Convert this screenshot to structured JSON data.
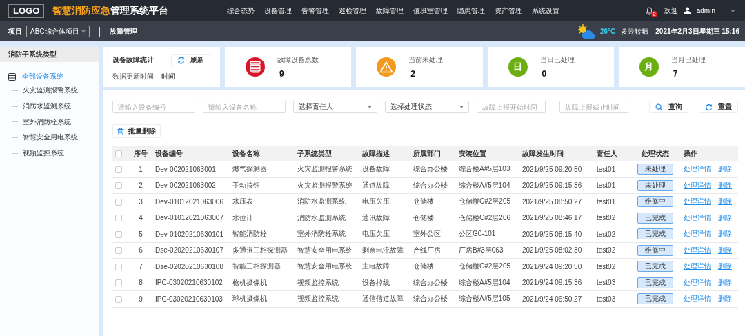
{
  "header": {
    "logo": "LOGO",
    "title_highlight": "智慧消防应急",
    "title_rest": "管理系统平台",
    "nav": [
      "综合态势",
      "设备管理",
      "告警管理",
      "巡检管理",
      "故障管理",
      "值班室管理",
      "隐患管理",
      "资产管理",
      "系统设置"
    ],
    "notification_count": "2",
    "welcome": "欢迎",
    "user": "admin"
  },
  "subbar": {
    "project_label": "项目",
    "project": "ABC综合体项目",
    "page_title": "故障管理",
    "temperature": "26°C",
    "weather": "多云转晴",
    "datetime": "2021年2月3日星期三 15:16"
  },
  "sidebar": {
    "title": "消防子系统类型",
    "tree": [
      {
        "label": "全部设备系统",
        "selected": true,
        "children": [
          {
            "label": "火灾监测报警系统",
            "selected": false
          },
          {
            "label": "消防水监测系统",
            "selected": false
          },
          {
            "label": "室外消防栓系统",
            "selected": false
          },
          {
            "label": "智慧安全用电系统",
            "selected": false
          },
          {
            "label": "视频监控系统",
            "selected": false
          }
        ]
      }
    ]
  },
  "summary": {
    "title": "设备故障统计",
    "refresh": "刷新",
    "updated_label": "数据更新时间:",
    "updated_value": "时间"
  },
  "stats": [
    {
      "kind": "server",
      "color": "#d9162a",
      "label": "故障设备总数",
      "value": "9"
    },
    {
      "kind": "warning",
      "color": "#f39a1e",
      "label": "当前未处理",
      "value": "2"
    },
    {
      "kind": "glyph",
      "glyph": "日",
      "color": "#6aae12",
      "label": "当日已处理",
      "value": "0"
    },
    {
      "kind": "glyph",
      "glyph": "月",
      "color": "#6aae12",
      "label": "当月已处理",
      "value": "7"
    }
  ],
  "filters": {
    "device_code": {
      "placeholder": "请输入设备编号"
    },
    "device_name": {
      "placeholder": "请输入设备名称"
    },
    "owner": "选择责任人",
    "status": "选择处理状态",
    "start": {
      "placeholder": "故障上报开始时间"
    },
    "separator": "–",
    "end": {
      "placeholder": "故障上报截止时间"
    },
    "search": "查询",
    "reset": "重置"
  },
  "batch_delete": "批量删除",
  "table": {
    "all_checked": false,
    "columns": [
      "序号",
      "设备编号",
      "设备名称",
      "子系统类型",
      "故障描述",
      "所属部门",
      "安装位置",
      "故障发生时间",
      "责任人",
      "处理状态",
      "操作"
    ],
    "rows": [
      {
        "checked": false,
        "no": "1",
        "code": "Dev-002021063001",
        "name": "燃气探测器",
        "subsystem": "火灾监测报警系统",
        "fault": "设备故障",
        "dept": "综合办公楼",
        "location": "综合楼A#5层103",
        "time": "2021/9/25 09:20:50",
        "owner": "test01",
        "status": "未处理",
        "actions": [
          "处理详情",
          "删除"
        ]
      },
      {
        "checked": false,
        "no": "2",
        "code": "Dev-002021063002",
        "name": "手动按钮",
        "subsystem": "火灾监测报警系统",
        "fault": "通道故障",
        "dept": "综合办公楼",
        "location": "综合楼A#5层104",
        "time": "2021/9/25 09:15:36",
        "owner": "test01",
        "status": "未处理",
        "actions": [
          "处理详情",
          "删除"
        ]
      },
      {
        "checked": false,
        "no": "3",
        "code": "Dev-01012021063006",
        "name": "水压表",
        "subsystem": "消防水监测系统",
        "fault": "电压欠压",
        "dept": "仓储楼",
        "location": "仓储楼C#2层205",
        "time": "2021/9/25 08:50:27",
        "owner": "test01",
        "status": "维修中",
        "actions": [
          "处理详情",
          "删除"
        ]
      },
      {
        "checked": false,
        "no": "4",
        "code": "Dev-01012021063007",
        "name": "水位计",
        "subsystem": "消防水监测系统",
        "fault": "通讯故障",
        "dept": "仓储楼",
        "location": "仓储楼C#2层206",
        "time": "2021/9/25 08:46:17",
        "owner": "test02",
        "status": "已完成",
        "actions": [
          "处理详情",
          "删除"
        ]
      },
      {
        "checked": false,
        "no": "5",
        "code": "Dev-01020210630101",
        "name": "智能消防栓",
        "subsystem": "室外消防栓系统",
        "fault": "电压欠压",
        "dept": "室外公区",
        "location": "公区G0-101",
        "time": "2021/9/25 08:15:40",
        "owner": "test02",
        "status": "已完成",
        "actions": [
          "处理详情",
          "删除"
        ]
      },
      {
        "checked": false,
        "no": "6",
        "code": "Dse-02020210630107",
        "name": "多通道三相探测器",
        "subsystem": "智慧安全用电系统",
        "fault": "剩余电流故障",
        "dept": "产线厂房",
        "location": "厂房B#3层063",
        "time": "2021/9/25 08:02:30",
        "owner": "test02",
        "status": "维修中",
        "actions": [
          "处理详情",
          "删除"
        ]
      },
      {
        "checked": false,
        "no": "7",
        "code": "Dse-02020210630108",
        "name": "智能三相探测器",
        "subsystem": "智慧安全用电系统",
        "fault": "主电故障",
        "dept": "仓储楼",
        "location": "仓储楼C#2层205",
        "time": "2021/9/24 09:20:50",
        "owner": "test02",
        "status": "已完成",
        "actions": [
          "处理详情",
          "删除"
        ]
      },
      {
        "checked": false,
        "no": "8",
        "code": "IPC-03020210630102",
        "name": "枪机摄像机",
        "subsystem": "视频监控系统",
        "fault": "设备掉线",
        "dept": "综合办公楼",
        "location": "综合楼A#5层104",
        "time": "2021/9/24 09:15:36",
        "owner": "test03",
        "status": "已完成",
        "actions": [
          "处理详情",
          "删除"
        ]
      },
      {
        "checked": false,
        "no": "9",
        "code": "IPC-03020210630103",
        "name": "球机摄像机",
        "subsystem": "视频监控系统",
        "fault": "通信信道故障",
        "dept": "综合办公楼",
        "location": "综合楼A#5层105",
        "time": "2021/9/24 06:50:27",
        "owner": "test03",
        "status": "已完成",
        "actions": [
          "处理详情",
          "删除"
        ]
      }
    ]
  }
}
